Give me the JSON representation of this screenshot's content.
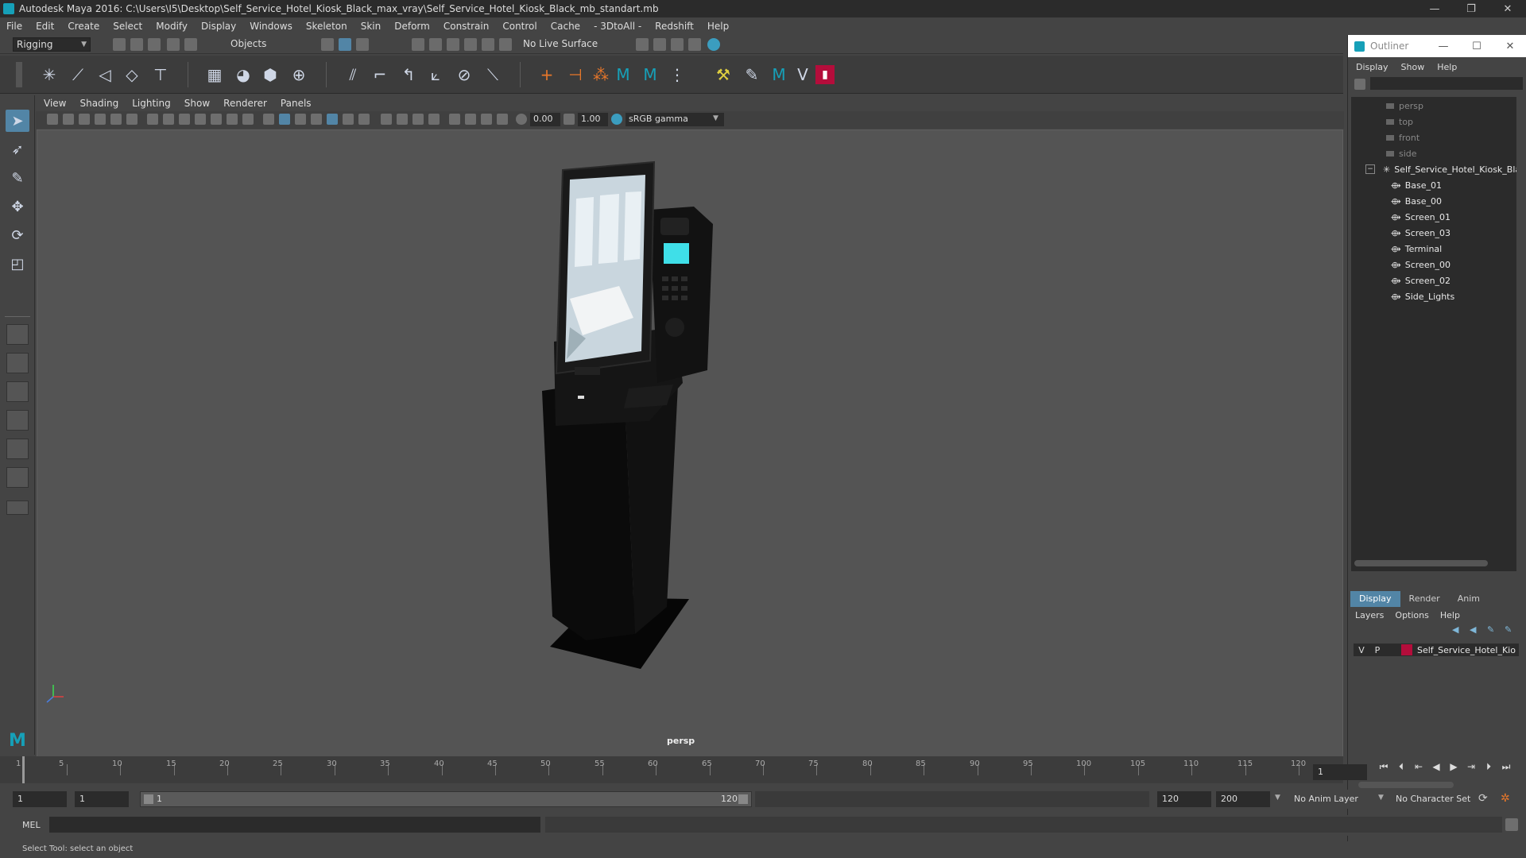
{
  "window": {
    "title": "Autodesk Maya 2016: C:\\Users\\I5\\Desktop\\Self_Service_Hotel_Kiosk_Black_max_vray\\Self_Service_Hotel_Kiosk_Black_mb_standart.mb",
    "minimize": "—",
    "maximize": "❐",
    "close": "✕"
  },
  "menubar": [
    "File",
    "Edit",
    "Create",
    "Select",
    "Modify",
    "Display",
    "Windows",
    "Skeleton",
    "Skin",
    "Deform",
    "Constrain",
    "Control",
    "Cache",
    "- 3DtoAll -",
    "Redshift",
    "Help"
  ],
  "statusline": {
    "mode": "Rigging",
    "objects_label": "Objects",
    "live_surface": "No Live Surface"
  },
  "viewport_panel": {
    "menu": [
      "View",
      "Shading",
      "Lighting",
      "Show",
      "Renderer",
      "Panels"
    ],
    "field_a": "0.00",
    "field_b": "1.00",
    "color_space": "sRGB gamma",
    "camera_label": "persp"
  },
  "outliner": {
    "title": "Outliner",
    "menu": [
      "Display",
      "Show",
      "Help"
    ],
    "cameras": [
      "persp",
      "top",
      "front",
      "side"
    ],
    "root": "Self_Service_Hotel_Kiosk_Bla",
    "children": [
      "Base_01",
      "Base_00",
      "Screen_01",
      "Screen_03",
      "Terminal",
      "Screen_00",
      "Screen_02",
      "Side_Lights"
    ]
  },
  "layer_editor": {
    "tabs": [
      "Display",
      "Render",
      "Anim"
    ],
    "menu": [
      "Layers",
      "Options",
      "Help"
    ],
    "layer": {
      "v": "V",
      "p": "P",
      "name": "Self_Service_Hotel_Kio",
      "color": "#b40d3b"
    }
  },
  "timeslider": {
    "tick_labels": [
      "1",
      "5",
      "10",
      "15",
      "20",
      "25",
      "30",
      "35",
      "40",
      "45",
      "50",
      "55",
      "60",
      "65",
      "70",
      "75",
      "80",
      "85",
      "90",
      "95",
      "100",
      "105",
      "110",
      "115",
      "120"
    ],
    "current_frame": "1"
  },
  "rangebar": {
    "start": "1",
    "playback_start": "1",
    "slider_start": "1",
    "slider_end": "120",
    "playback_end": "120",
    "end": "200",
    "anim_layer": "No Anim Layer",
    "character_set": "No Character Set"
  },
  "cmdline": {
    "label": "MEL"
  },
  "helpline": "Select Tool: select an object",
  "colors": {
    "accent": "#5285a6",
    "maya_teal": "#16a0b8"
  }
}
